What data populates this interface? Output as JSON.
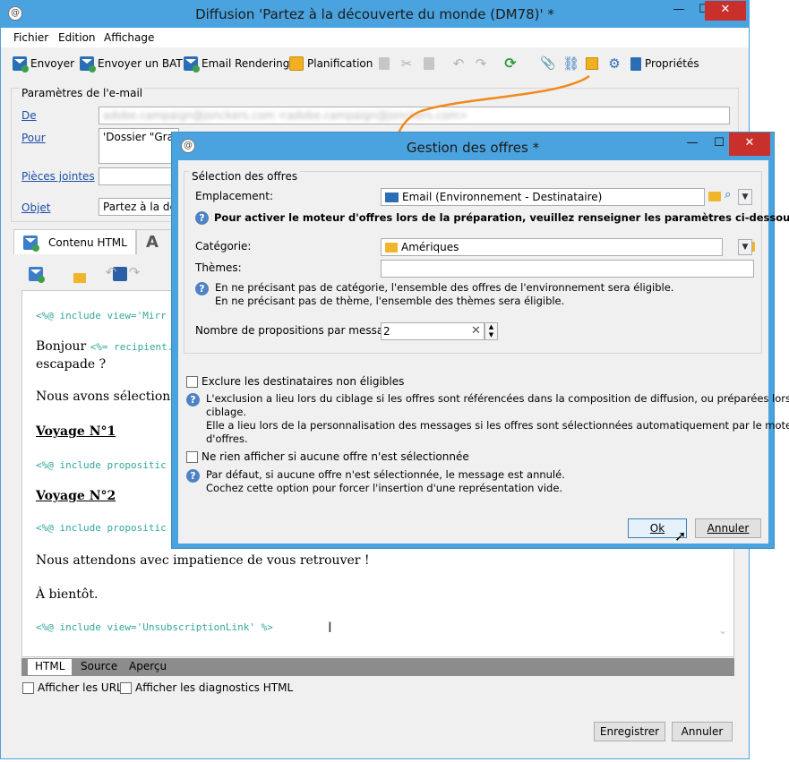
{
  "main": {
    "title": "Diffusion 'Partez à la découverte du monde (DM78)' *",
    "menu": [
      "Fichier",
      "Edition",
      "Affichage"
    ],
    "toolbar": {
      "send": "Envoyer",
      "send_bat": "Envoyer un BAT",
      "email_rendering": "Email Rendering",
      "planning": "Planification",
      "properties": "Propriétés"
    },
    "params": {
      "legend": "Paramètres de l'e-mail",
      "from_label": "De",
      "from_value": "adobe.campaign@jonckers.com <adobe.campaign@jonckers.com>",
      "to_label": "Pour",
      "to_value": "'Dossier \"Grand",
      "attachments_label": "Pièces jointes",
      "subject_label": "Objet",
      "subject_value": "Partez à la déco"
    },
    "tabs": {
      "html_content": "Contenu HTML"
    },
    "editor": {
      "l1": "<%@ include view='Mirr",
      "l2a": "Bonjour ",
      "l2b": "<%= recipient..",
      "l3": "escapade ?",
      "l4": "Nous avons sélectionné s",
      "l5": "Voyage N°1",
      "l6": "<%@ include propositic",
      "l7": "Voyage N°2",
      "l8": "<%@ include propositic",
      "l9": "Nous attendons avec impatience de vous retrouver !",
      "l10": "À bientôt.",
      "l11": "<%@ include view='UnsubscriptionLink' %>"
    },
    "bottom_tabs": [
      "HTML",
      "Source",
      "Aperçu"
    ],
    "show_urls": "Afficher les URL",
    "show_diag": "Afficher les diagnostics HTML",
    "save": "Enregistrer",
    "cancel": "Annuler"
  },
  "dialog": {
    "title": "Gestion des offres *",
    "group_label": "Sélection des offres",
    "location_label": "Emplacement:",
    "location_value": "Email (Environnement - Destinataire)",
    "engine_help": "Pour activer le moteur d'offres lors de la préparation, veuillez renseigner les paramètres ci-dessous.",
    "category_label": "Catégorie:",
    "category_value": "Amériques",
    "themes_label": "Thèmes:",
    "cat_note_1": "En ne précisant pas de catégorie, l'ensemble des offres de l'environnement sera éligible.",
    "cat_note_2": "En ne précisant pas de thème, l'ensemble des thèmes sera éligible.",
    "proposals_label": "Nombre de propositions par message:",
    "proposals_value": "2",
    "exclude_label": "Exclure les destinataires non éligibles",
    "exclude_note_1": "L'exclusion a lieu lors du ciblage si les offres sont référencées dans la composition de diffusion, ou préparées lors du",
    "exclude_note_2": "ciblage.",
    "exclude_note_3": "Elle a lieu lors de la personnalisation des messages si les offres sont sélectionnées automatiquement par le moteur",
    "exclude_note_4": "d'offres.",
    "nothing_label": "Ne rien afficher si aucune offre n'est sélectionnée",
    "nothing_note_1": "Par défaut, si aucune offre n'est sélectionnée, le message est annulé.",
    "nothing_note_2": "Cochez cette option pour forcer l'insertion d'une représentation vide.",
    "ok": "Ok",
    "cancel": "Annuler"
  },
  "colors": {
    "titlebar": "#4aa3df",
    "close": "#c9302c",
    "arrow": "#f08a1c",
    "code": "#33a69e"
  }
}
